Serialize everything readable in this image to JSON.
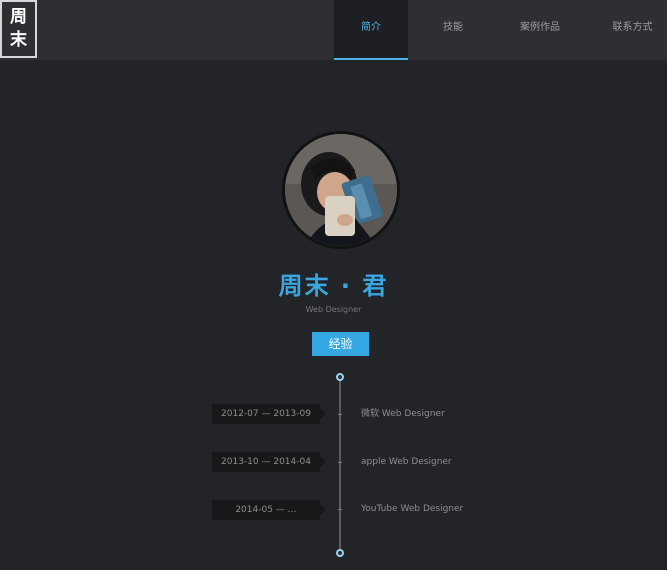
{
  "header": {
    "logo_line1": "周",
    "logo_line2": "末",
    "nav": [
      {
        "label": "简介"
      },
      {
        "label": "技能"
      },
      {
        "label": "案例作品"
      },
      {
        "label": "联系方式"
      }
    ]
  },
  "profile": {
    "name": "周末 · 君",
    "title": "Web Designer",
    "experience_button": "经验"
  },
  "timeline": [
    {
      "date": "2012-07 — 2013-09",
      "job": "微软 Web Designer"
    },
    {
      "date": "2013-10 — 2014-04",
      "job": "apple Web Designer"
    },
    {
      "date": "2014-05 — …",
      "job": "YouTube Web Designer"
    }
  ],
  "colors": {
    "accent": "#3aa6e0",
    "background": "#222428",
    "header": "#2e2f33"
  }
}
